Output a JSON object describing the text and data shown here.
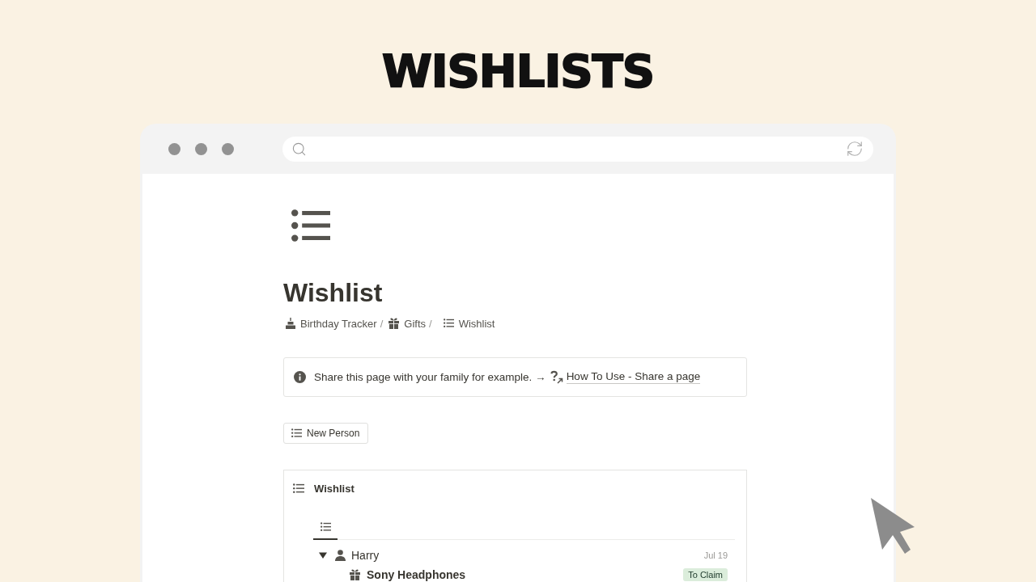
{
  "headline": "WISHLISTS",
  "page": {
    "title": "Wishlist",
    "breadcrumb": [
      {
        "kind": "cake",
        "label": "Birthday Tracker",
        "separator": "/"
      },
      {
        "kind": "gift",
        "label": "Gifts",
        "separator": "/"
      },
      {
        "kind": "list",
        "label": "Wishlist"
      }
    ]
  },
  "callout": {
    "text": "Share this page with your family for example. →",
    "link": "How To Use - Share a page"
  },
  "new_button": {
    "label": "New Person"
  },
  "database": {
    "title": "Wishlist",
    "views": [
      {
        "kind": "list",
        "selected": true
      }
    ],
    "groups": [
      {
        "name": "Harry",
        "expanded": true,
        "date": "Jul 19",
        "items": [
          {
            "kind": "gift",
            "name": "Sony Headphones",
            "status": "To Claim"
          }
        ]
      }
    ]
  }
}
